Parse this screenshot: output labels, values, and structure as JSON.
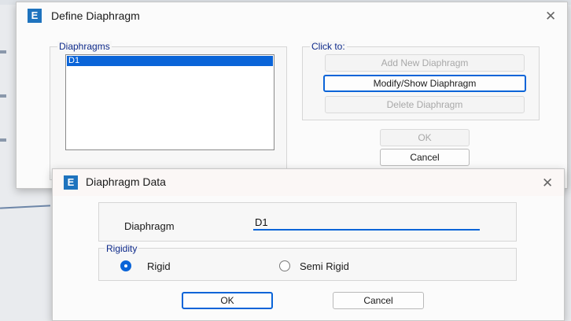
{
  "define_dialog": {
    "icon_letter": "E",
    "title": "Define Diaphragm",
    "close_glyph": "✕",
    "diaphragms_group_label": "Diaphragms",
    "diaphragms": [
      "D1"
    ],
    "click_to_label": "Click to:",
    "add_button": "Add New Diaphragm",
    "modify_button": "Modify/Show Diaphragm",
    "delete_button": "Delete Diaphragm",
    "ok_button": "OK",
    "cancel_button": "Cancel"
  },
  "data_dialog": {
    "icon_letter": "E",
    "title": "Diaphragm Data",
    "close_glyph": "✕",
    "diaphragm_label": "Diaphragm",
    "diaphragm_value": "D1",
    "rigidity_label": "Rigidity",
    "options": [
      "Rigid",
      "Semi Rigid"
    ],
    "selected_option": "Rigid",
    "ok_button": "OK",
    "cancel_button": "Cancel"
  },
  "colors": {
    "accent": "#0a64d8",
    "group_label": "#0e2a8a",
    "icon": "#1e73be"
  }
}
